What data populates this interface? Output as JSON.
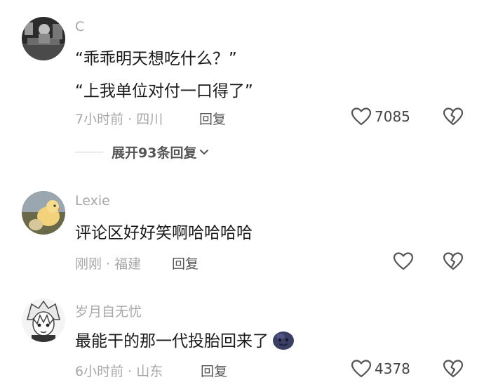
{
  "comments": [
    {
      "username": "C",
      "lines": [
        "“乖乖明天想吃什么？”",
        "“上我单位对付一口得了”"
      ],
      "meta": "7小时前 · 四川",
      "reply_label": "回复",
      "likes": "7085",
      "expand_label": "展开93条回复"
    },
    {
      "username": "Lexie",
      "lines": [
        "评论区好好笑啊哈哈哈哈"
      ],
      "meta": "刚刚 · 福建",
      "reply_label": "回复",
      "likes": ""
    },
    {
      "username": "岁月自无忧",
      "lines": [
        "最能干的那一代投胎回来了"
      ],
      "meta": "6小时前 · 山东",
      "reply_label": "回复",
      "likes": "4378"
    }
  ],
  "icons": {
    "like": "heart-outline-icon",
    "dislike": "broken-heart-icon",
    "expand": "chevron-down-icon",
    "emoji": "smiling-face-emoji-icon"
  },
  "colors": {
    "text_primary": "#1a1a1a",
    "text_secondary": "#a8a8a8",
    "icon": "#555555"
  }
}
